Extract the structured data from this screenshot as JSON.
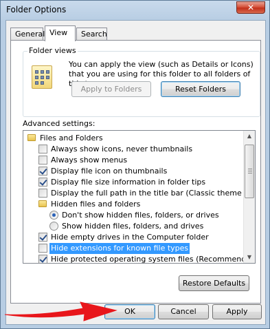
{
  "window": {
    "title": "Folder Options",
    "close_glyph": "✕"
  },
  "tabs": [
    {
      "label": "General"
    },
    {
      "label": "View"
    },
    {
      "label": "Search"
    }
  ],
  "folder_views": {
    "title": "Folder views",
    "description": "You can apply the view (such as Details or Icons) that you are using for this folder to all folders of this type.",
    "apply_label": "Apply to Folders",
    "reset_label": "Reset Folders"
  },
  "advanced": {
    "label": "Advanced settings:",
    "items": [
      {
        "type": "folder",
        "label": "Files and Folders",
        "level": 0
      },
      {
        "type": "checkbox",
        "label": "Always show icons, never thumbnails",
        "checked": false,
        "level": 1
      },
      {
        "type": "checkbox",
        "label": "Always show menus",
        "checked": false,
        "level": 1
      },
      {
        "type": "checkbox",
        "label": "Display file icon on thumbnails",
        "checked": true,
        "level": 1
      },
      {
        "type": "checkbox",
        "label": "Display file size information in folder tips",
        "checked": true,
        "level": 1
      },
      {
        "type": "checkbox",
        "label": "Display the full path in the title bar (Classic theme only)",
        "checked": false,
        "level": 1
      },
      {
        "type": "folder",
        "label": "Hidden files and folders",
        "level": 1
      },
      {
        "type": "radio",
        "label": "Don't show hidden files, folders, or drives",
        "checked": true,
        "level": 2
      },
      {
        "type": "radio",
        "label": "Show hidden files, folders, and drives",
        "checked": false,
        "level": 2
      },
      {
        "type": "checkbox",
        "label": "Hide empty drives in the Computer folder",
        "checked": true,
        "level": 1
      },
      {
        "type": "checkbox",
        "label": "Hide extensions for known file types",
        "checked": false,
        "level": 1,
        "selected": true
      },
      {
        "type": "checkbox",
        "label": "Hide protected operating system files (Recommended)",
        "checked": true,
        "level": 1
      }
    ],
    "restore_label": "Restore Defaults"
  },
  "footer": {
    "ok_label": "OK",
    "cancel_label": "Cancel",
    "apply_label": "Apply"
  },
  "annotation": {
    "arrow_color": "#e8161b"
  }
}
